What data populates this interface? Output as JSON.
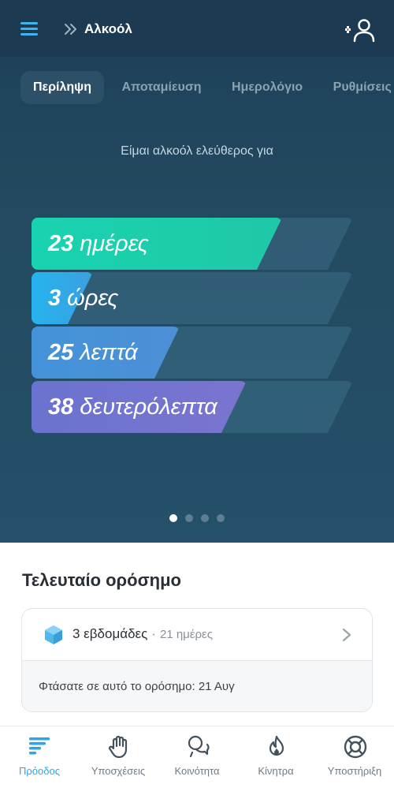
{
  "header": {
    "title": "Αλκοόλ",
    "icons": {
      "menu": "hamburger-menu-icon",
      "breadcrumb": "double-chevron-right-icon",
      "profile": "user-settings-icon"
    }
  },
  "tabs": [
    {
      "label": "Περίληψη",
      "active": true
    },
    {
      "label": "Αποταμίευση",
      "active": false
    },
    {
      "label": "Ημερολόγιο",
      "active": false
    },
    {
      "label": "Ρυθμίσεις",
      "active": false
    }
  ],
  "hero": {
    "subtitle": "Είμαι αλκοόλ ελεύθερος για",
    "counters": [
      {
        "value": "23",
        "unit": "ημέρες",
        "fill_fraction": 0.78,
        "color": "#19d3b0",
        "color2": "#1fc8a7"
      },
      {
        "value": "3",
        "unit": "ώρες",
        "fill_fraction": 0.19,
        "color": "#27b3ee",
        "color2": "#3aa0e0"
      },
      {
        "value": "25",
        "unit": "λεπτά",
        "fill_fraction": 0.46,
        "color": "#4493d8",
        "color2": "#4d8fd6"
      },
      {
        "value": "38",
        "unit": "δευτερόλεπτα",
        "fill_fraction": 0.67,
        "color": "#6a73cf",
        "color2": "#7a74d0"
      }
    ],
    "pager": {
      "count": 4,
      "active_index": 0
    }
  },
  "milestone": {
    "section_title": "Τελευταίο ορόσημο",
    "name": "3 εβδομάδες",
    "separator": "·",
    "days": "21 ημέρες",
    "reached_text": "Φτάσατε σε αυτό το ορόσημο: 21 Αυγ",
    "icon": "hexagon-gem-icon",
    "icon_color": "#4fb8ec"
  },
  "bottom_nav": [
    {
      "label": "Πρόοδος",
      "icon": "progress-bars-icon",
      "active": true
    },
    {
      "label": "Υποσχέσεις",
      "icon": "raised-hand-icon",
      "active": false
    },
    {
      "label": "Κοινότητα",
      "icon": "chat-bubbles-icon",
      "active": false
    },
    {
      "label": "Κίνητρα",
      "icon": "flame-icon",
      "active": false
    },
    {
      "label": "Υποστήριξη",
      "icon": "lifebuoy-icon",
      "active": false
    }
  ],
  "colors": {
    "accent": "#2aa6ea",
    "hero_bg": "#234a60",
    "topbar_bg": "#1c3a52"
  }
}
